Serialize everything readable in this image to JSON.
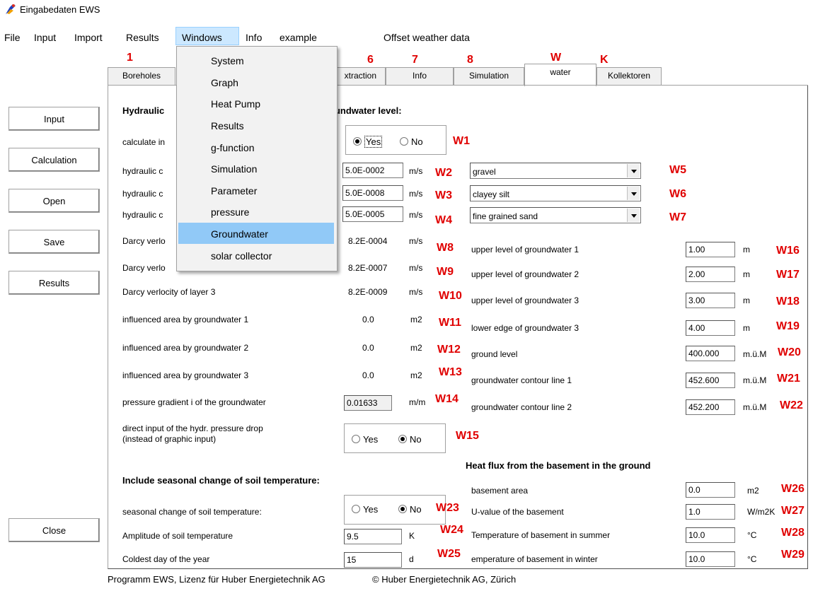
{
  "window": {
    "title": "Eingabedaten EWS"
  },
  "menubar": [
    "File",
    "Input",
    "Import",
    "Results",
    "Windows",
    "Info",
    "example",
    "Offset weather data"
  ],
  "dropdown": [
    "System",
    "Graph",
    "Heat Pump",
    "Results",
    "g-function",
    "Simulation",
    "Parameter",
    "pressure",
    "Groundwater",
    "solar collector"
  ],
  "tabs": {
    "boreholes": "Boreholes",
    "extraction": "xtraction",
    "info": "Info",
    "simulation": "Simulation",
    "water": "water",
    "kollektoren": "Kollektoren"
  },
  "tab_markers": {
    "m1": "1",
    "m6": "6",
    "m7": "7",
    "m8": "8",
    "mw": "W",
    "mk": "K"
  },
  "side_buttons": {
    "input": "Input",
    "calculation": "Calculation",
    "open": "Open",
    "save": "Save",
    "results": "Results",
    "close": "Close"
  },
  "left": {
    "header": "Hydraulic",
    "header_tail": "oundwater level:",
    "calc_label": "calculate in",
    "hc1": "hydraulic c",
    "hc2": "hydraulic c",
    "hc3": "hydraulic c",
    "darcy1_label": "Darcy verlo",
    "darcy2_label": "Darcy verlo",
    "darcy3_label": "Darcy verlocity of layer 3",
    "area1_label": "influenced area by groundwater 1",
    "area2_label": "influenced area by groundwater 2",
    "area3_label": "influenced area by groundwater 3",
    "pressure_label": "pressure gradient i of the groundwater",
    "direct_label1": "direct input of the hydr. pressure drop",
    "direct_label2": "(instead of graphic input)",
    "seasonal_header": "Include seasonal change of soil temperature:",
    "seasonal_label": "seasonal change of soil temperature:",
    "amplitude_label": "Amplitude of soil temperature",
    "coldest_label": "Coldest day of the year"
  },
  "values": {
    "yes": "Yes",
    "no": "No",
    "hc1": "5.0E-0002",
    "hc2": "5.0E-0008",
    "hc3": "5.0E-0005",
    "unit_ms": "m/s",
    "soil1": "gravel",
    "soil2": "clayey silt",
    "soil3": "fine grained sand",
    "darcy1": "8.2E-0004",
    "darcy2": "8.2E-0007",
    "darcy3": "8.2E-0009",
    "area1": "0.0",
    "area2": "0.0",
    "area3": "0.0",
    "unit_m2": "m2",
    "pressure": "0.01633",
    "unit_mm": "m/m",
    "amplitude": "9.5",
    "unit_k": "K",
    "coldest": "15",
    "unit_d": "d"
  },
  "right": {
    "upper1": "upper level of groundwater 1",
    "upper1_val": "1.00",
    "upper2": "upper level of groundwater 2",
    "upper2_val": "2.00",
    "upper3": "upper level of groundwater 3",
    "upper3_val": "3.00",
    "lower3": "lower edge of groundwater 3",
    "lower3_val": "4.00",
    "unit_m": "m",
    "ground": "ground level",
    "ground_val": "400.000",
    "contour1": "groundwater contour line 1",
    "contour1_val": "452.600",
    "contour2": "groundwater contour line 2",
    "contour2_val": "452.200",
    "unit_muem": "m.ü.M",
    "heat_header": "Heat flux from the basement in the ground",
    "basement_area": "basement area",
    "basement_area_val": "0.0",
    "unit_m2": "m2",
    "u_value": "U-value of the basement",
    "u_value_val": "1.0",
    "unit_wm2k": "W/m2K",
    "summer": "Temperature of basement in summer",
    "summer_val": "10.0",
    "winter": "emperature of basement in winter",
    "winter_val": "10.0",
    "unit_c": "°C"
  },
  "markers": {
    "W1": "W1",
    "W2": "W2",
    "W3": "W3",
    "W4": "W4",
    "W5": "W5",
    "W6": "W6",
    "W7": "W7",
    "W8": "W8",
    "W9": "W9",
    "W10": "W10",
    "W11": "W11",
    "W12": "W12",
    "W13": "W13",
    "W14": "W14",
    "W15": "W15",
    "W16": "W16",
    "W17": "W17",
    "W18": "W18",
    "W19": "W19",
    "W20": "W20",
    "W21": "W21",
    "W22": "W22",
    "W23": "W23",
    "W24": "W24",
    "W25": "W25",
    "W26": "W26",
    "W27": "W27",
    "W28": "W28",
    "W29": "W29"
  },
  "footer": {
    "license": "Programm EWS, Lizenz für Huber Energietechnik AG",
    "copyright": "© Huber Energietechnik AG, Zürich"
  }
}
